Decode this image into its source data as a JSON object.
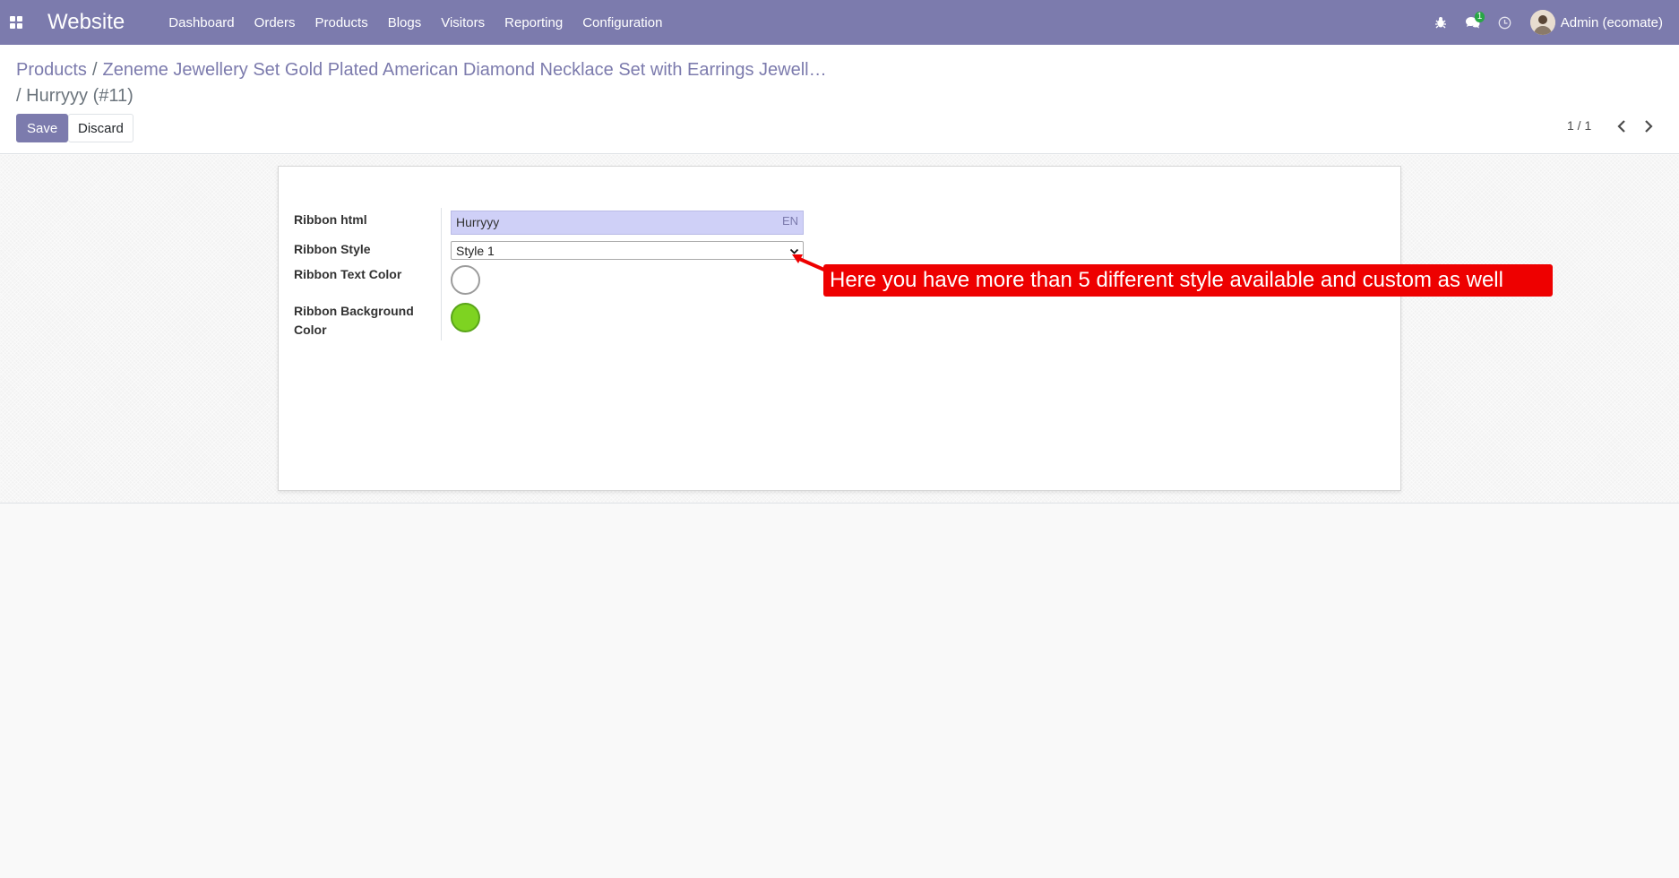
{
  "navbar": {
    "app_title": "Website",
    "menu": [
      "Dashboard",
      "Orders",
      "Products",
      "Blogs",
      "Visitors",
      "Reporting",
      "Configuration"
    ],
    "messages_badge": "1",
    "user": "Admin (ecomate)",
    "color": "#7c7bad"
  },
  "breadcrumb": {
    "root": "Products",
    "product": "Zeneme Jewellery Set Gold Plated American Diamond Necklace Set with Earrings Jewell…",
    "current": "Hurryyy (#11)"
  },
  "actions": {
    "save": "Save",
    "discard": "Discard"
  },
  "pager": {
    "value": "1 / 1"
  },
  "form": {
    "ribbon_html_label": "Ribbon html",
    "ribbon_html_value": "Hurryyy",
    "lang": "EN",
    "ribbon_style_label": "Ribbon Style",
    "ribbon_style_value": "Style 1",
    "text_color_label": "Ribbon Text Color",
    "text_color": "#ffffff",
    "bg_color_label": "Ribbon Background Color",
    "bg_color": "#7ed321"
  },
  "annotation": {
    "text": "Here you have more than 5 different style available and custom as well",
    "color": "#ee0000"
  }
}
